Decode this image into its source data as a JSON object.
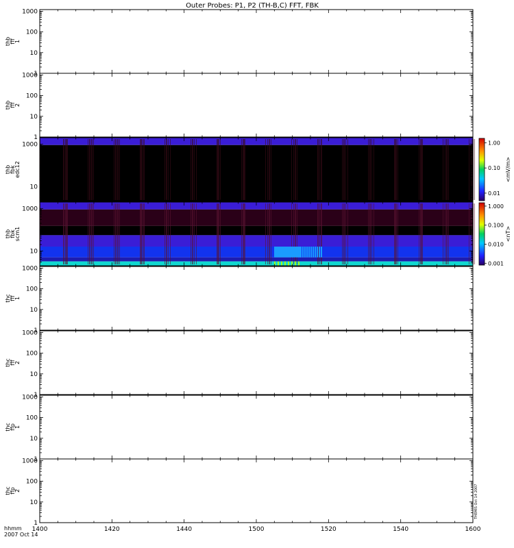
{
  "page": {
    "title": "Outer Probes: P1, P2 (TH-B,C) FFT, FBK",
    "xaxis_label_1": "hhmm",
    "xaxis_label_2": "2007 Oct 14",
    "side_stamp": "THEMIS Oct 14 2007"
  },
  "chart_data": [
    {
      "type": "heatmap",
      "ylabel": [
        "thb",
        "fff",
        "1"
      ],
      "yscale": "log",
      "ylim": [
        1,
        1200
      ],
      "yticks": [
        "1",
        "10",
        "100",
        "1000"
      ],
      "xlim": [
        1400,
        1600
      ],
      "has_data": false
    },
    {
      "type": "heatmap",
      "ylabel": [
        "thb",
        "fff",
        "2"
      ],
      "yscale": "log",
      "ylim": [
        1,
        1200
      ],
      "yticks": [
        "1",
        "10",
        "100",
        "1000"
      ],
      "xlim": [
        1400,
        1600
      ],
      "has_data": false
    },
    {
      "type": "heatmap",
      "ylabel": [
        "thb",
        "fbk",
        "edc12"
      ],
      "yscale": "log",
      "ylim": [
        2,
        2000
      ],
      "yticks": [
        "10",
        "1000"
      ],
      "xlim": [
        1400,
        1600
      ],
      "has_data": true,
      "colorbar": {
        "label": "<mV/m>",
        "scale": "log",
        "range": [
          0.005,
          1.5
        ],
        "ticks": [
          "1.00",
          "0.10",
          "0.01"
        ]
      },
      "bands": [
        {
          "ymin": 900,
          "ymax": 2000,
          "color": "#3a1dd6"
        },
        {
          "ymin": 2,
          "ymax": 900,
          "color": "#000000"
        }
      ]
    },
    {
      "type": "heatmap",
      "ylabel": [
        "thb",
        "fbk",
        "scm1"
      ],
      "yscale": "log",
      "ylim": [
        2,
        2000
      ],
      "yticks": [
        "10",
        "1000"
      ],
      "xlim": [
        1400,
        1600
      ],
      "has_data": true,
      "colorbar": {
        "label": "<nT>",
        "scale": "log",
        "range": [
          0.0008,
          1.5
        ],
        "ticks": [
          "1.000",
          "0.100",
          "0.010",
          "0.001"
        ]
      },
      "bands": [
        {
          "ymin": 900,
          "ymax": 2000,
          "color": "#3a1dd6"
        },
        {
          "ymin": 150,
          "ymax": 900,
          "color": "#2a0018"
        },
        {
          "ymin": 55,
          "ymax": 150,
          "color": "#000000"
        },
        {
          "ymin": 16,
          "ymax": 55,
          "color": "#3a1dd6"
        },
        {
          "ymin": 5,
          "ymax": 16,
          "color": "#1233ee"
        },
        {
          "ymin": 3.2,
          "ymax": 5,
          "color": "#1d1db0"
        },
        {
          "ymin": 2,
          "ymax": 3.2,
          "color": "#10d8d0"
        }
      ]
    },
    {
      "type": "heatmap",
      "ylabel": [
        "thc",
        "fff",
        "1"
      ],
      "yscale": "log",
      "ylim": [
        1,
        1200
      ],
      "yticks": [
        "1",
        "10",
        "100",
        "1000"
      ],
      "xlim": [
        1400,
        1600
      ],
      "has_data": false
    },
    {
      "type": "heatmap",
      "ylabel": [
        "thc",
        "fff",
        "2"
      ],
      "yscale": "log",
      "ylim": [
        1,
        1200
      ],
      "yticks": [
        "1",
        "10",
        "100",
        "1000"
      ],
      "xlim": [
        1400,
        1600
      ],
      "has_data": false
    },
    {
      "type": "heatmap",
      "ylabel": [
        "thc",
        "ffp",
        "1"
      ],
      "yscale": "log",
      "ylim": [
        1,
        1200
      ],
      "yticks": [
        "1",
        "10",
        "100",
        "1000"
      ],
      "xlim": [
        1400,
        1600
      ],
      "has_data": false
    },
    {
      "type": "heatmap",
      "ylabel": [
        "thc",
        "ffp",
        "2"
      ],
      "yscale": "log",
      "ylim": [
        1,
        1200
      ],
      "yticks": [
        "1",
        "10",
        "100",
        "1000"
      ],
      "xlim": [
        1400,
        1600
      ],
      "has_data": false
    }
  ],
  "xaxis": {
    "ticks": [
      "1400",
      "1420",
      "1440",
      "1500",
      "1520",
      "1540",
      "1600"
    ]
  }
}
